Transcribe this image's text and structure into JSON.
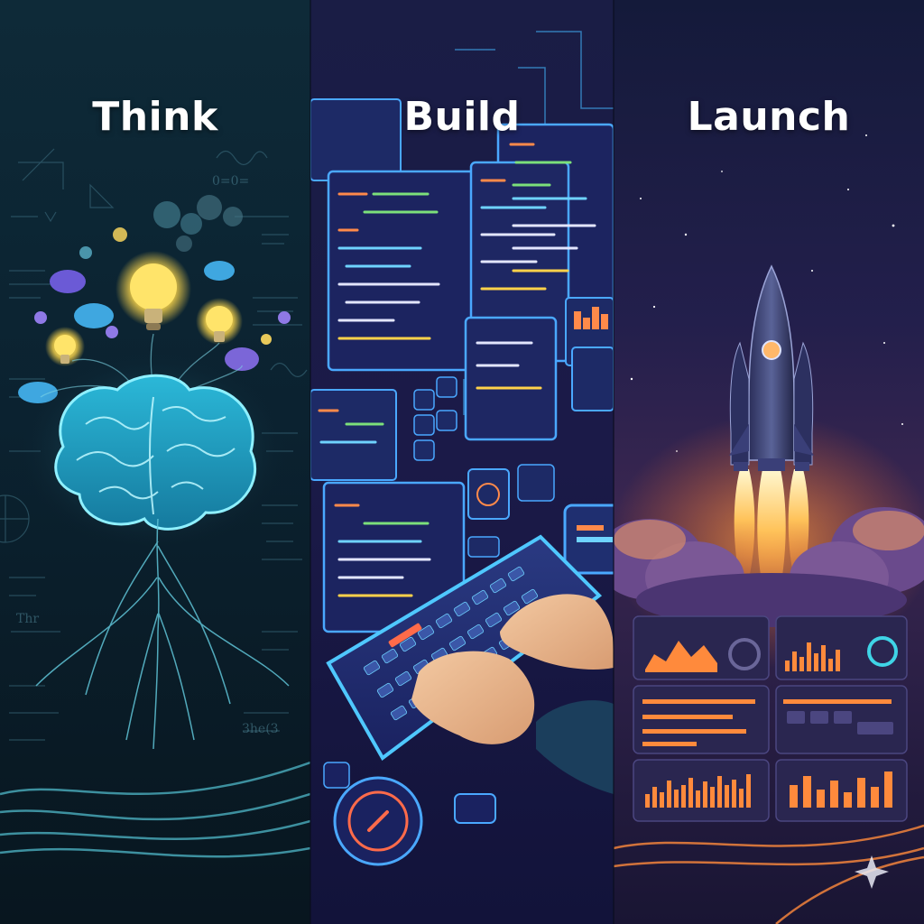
{
  "panels": [
    {
      "id": "think",
      "title": "Think",
      "illustration": "glowing-brain-with-lightbulbs",
      "accent": "#3fd4e6"
    },
    {
      "id": "build",
      "title": "Build",
      "illustration": "hands-typing-on-glowing-keyboard-with-code-screens",
      "accent": "#4aa8ff"
    },
    {
      "id": "launch",
      "title": "Launch",
      "illustration": "rocket-launching-above-dashboards",
      "accent": "#ff9a3c"
    }
  ],
  "decor": {
    "sparkle": "four-point-star-icon"
  }
}
